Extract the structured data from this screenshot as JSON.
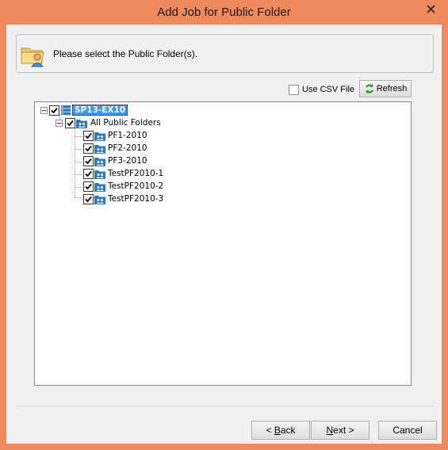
{
  "window": {
    "title": "Add Job for Public Folder"
  },
  "header": {
    "text": "Please select the Public Folder(s)."
  },
  "options": {
    "csv_label": "Use CSV File",
    "csv_checked": false,
    "refresh_label": "Refresh"
  },
  "tree": {
    "server": {
      "label": "SP13-EX10",
      "checked": true
    },
    "root": {
      "label": "All Public Folders",
      "checked": true
    },
    "folders": [
      {
        "label": "PF1-2010",
        "checked": true
      },
      {
        "label": "PF2-2010",
        "checked": true
      },
      {
        "label": "PF3-2010",
        "checked": true
      },
      {
        "label": "TestPF2010-1",
        "checked": true
      },
      {
        "label": "TestPF2010-2",
        "checked": true
      },
      {
        "label": "TestPF2010-3",
        "checked": true
      }
    ]
  },
  "footer": {
    "back_prefix": "< ",
    "back_accel": "B",
    "back_rest": "ack",
    "next_accel": "N",
    "next_rest": "ext >",
    "cancel_label": "Cancel"
  },
  "icons": {
    "close": "close-icon",
    "header": "folder-user-icon",
    "refresh": "refresh-icon",
    "server": "server-icon",
    "public_folder": "public-folder-icon"
  },
  "colors": {
    "titlebar": "#f0895c",
    "selection": "#3399ff",
    "folder_icon": "#2b78c5"
  }
}
